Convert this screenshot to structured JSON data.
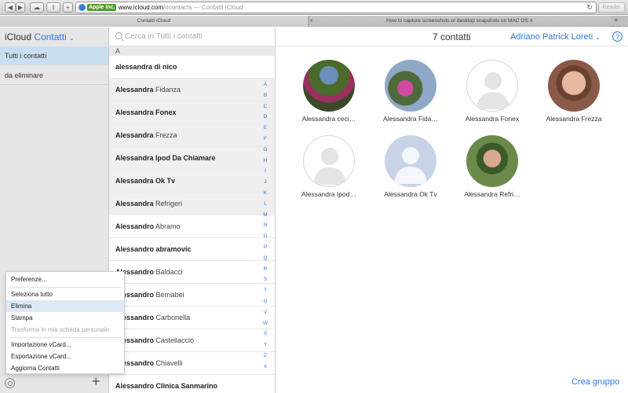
{
  "browser": {
    "back": "◀",
    "forward": "▶",
    "cloud": "☁",
    "share": "⇪",
    "add": "+",
    "secure_label": "Apple Inc.",
    "url_domain": "www.icloud.com",
    "url_rest": "/#contacts — Contatti iCloud",
    "reload": "↻",
    "reader": "Reader",
    "tabs": [
      {
        "label": "Contatti iCloud"
      },
      {
        "label": "How to capture screenshots or desktop snapshots on MAC OS X"
      }
    ],
    "tab_close": "x",
    "tab_plus": "+"
  },
  "sidebar": {
    "brand": "iCloud",
    "section": "Contatti",
    "items": [
      {
        "label": "Tutti i contatti"
      },
      {
        "label": "da eliminare"
      }
    ]
  },
  "search": {
    "placeholder": "Cerca in Tutti i contatti"
  },
  "list": {
    "section": "A",
    "rows": [
      {
        "first": "alessandra di nico",
        "last": ""
      },
      {
        "first": "Alessandra",
        "last": "Fidanza"
      },
      {
        "first": "Alessandra Fonex",
        "last": ""
      },
      {
        "first": "Alessandra",
        "last": "Frezza"
      },
      {
        "first": "Alessandra Ipod Da Chiamare",
        "last": ""
      },
      {
        "first": "Alessandra Ok Tv",
        "last": ""
      },
      {
        "first": "Alessandra",
        "last": "Refrigeri"
      },
      {
        "first": "Alessandro",
        "last": "Abramo"
      },
      {
        "first": "Alessandro abramovic",
        "last": ""
      },
      {
        "first": "Alessandro",
        "last": "Baldacci"
      },
      {
        "first": "Alessandro",
        "last": "Bernabei"
      },
      {
        "first": "Alessandro",
        "last": "Carbonella"
      },
      {
        "first": "Alessandro",
        "last": "Castellaccio"
      },
      {
        "first": "Alessandro",
        "last": "Chiavelli"
      },
      {
        "first": "Alessandro Clinica Sanmarino",
        "last": ""
      }
    ],
    "alphabet": [
      "A",
      "B",
      "C",
      "D",
      "E",
      "F",
      "G",
      "H",
      "I",
      "J",
      "K",
      "L",
      "M",
      "N",
      "O",
      "P",
      "Q",
      "R",
      "S",
      "T",
      "U",
      "V",
      "W",
      "X",
      "Y",
      "Z",
      "#"
    ]
  },
  "main": {
    "count": "7 contatti",
    "user": "Adriano Patrick Loreti",
    "help": "?",
    "cards": [
      {
        "name": "Alessandra ceci…",
        "avatar": "photo"
      },
      {
        "name": "Alessandra Fida…",
        "avatar": "photo"
      },
      {
        "name": "Alessandra Fonex",
        "avatar": "placeholder"
      },
      {
        "name": "Alessandra Frezza",
        "avatar": "photo"
      },
      {
        "name": "Alessandra Ipod…",
        "avatar": "placeholder"
      },
      {
        "name": "Alessandra Ok Tv",
        "avatar": "facebook-silhouette"
      },
      {
        "name": "Alessandra Refri…",
        "avatar": "photo"
      }
    ],
    "create_group": "Crea gruppo"
  },
  "menu": {
    "items": [
      {
        "label": "Preferenze..."
      },
      {
        "label": "Seleziona tutto"
      },
      {
        "label": "Elimina"
      },
      {
        "label": "Stampa"
      },
      {
        "label": "Trasforma in mia scheda personale"
      },
      {
        "label": "Importazione vCard..."
      },
      {
        "label": "Esportazione vCard..."
      },
      {
        "label": "Aggiorna Contatti"
      }
    ]
  },
  "footer": {
    "plus": "+"
  },
  "colors": {
    "accent": "#2a7ae4",
    "selected": "#c9dff1",
    "menu_highlight": "#dce9f7"
  }
}
